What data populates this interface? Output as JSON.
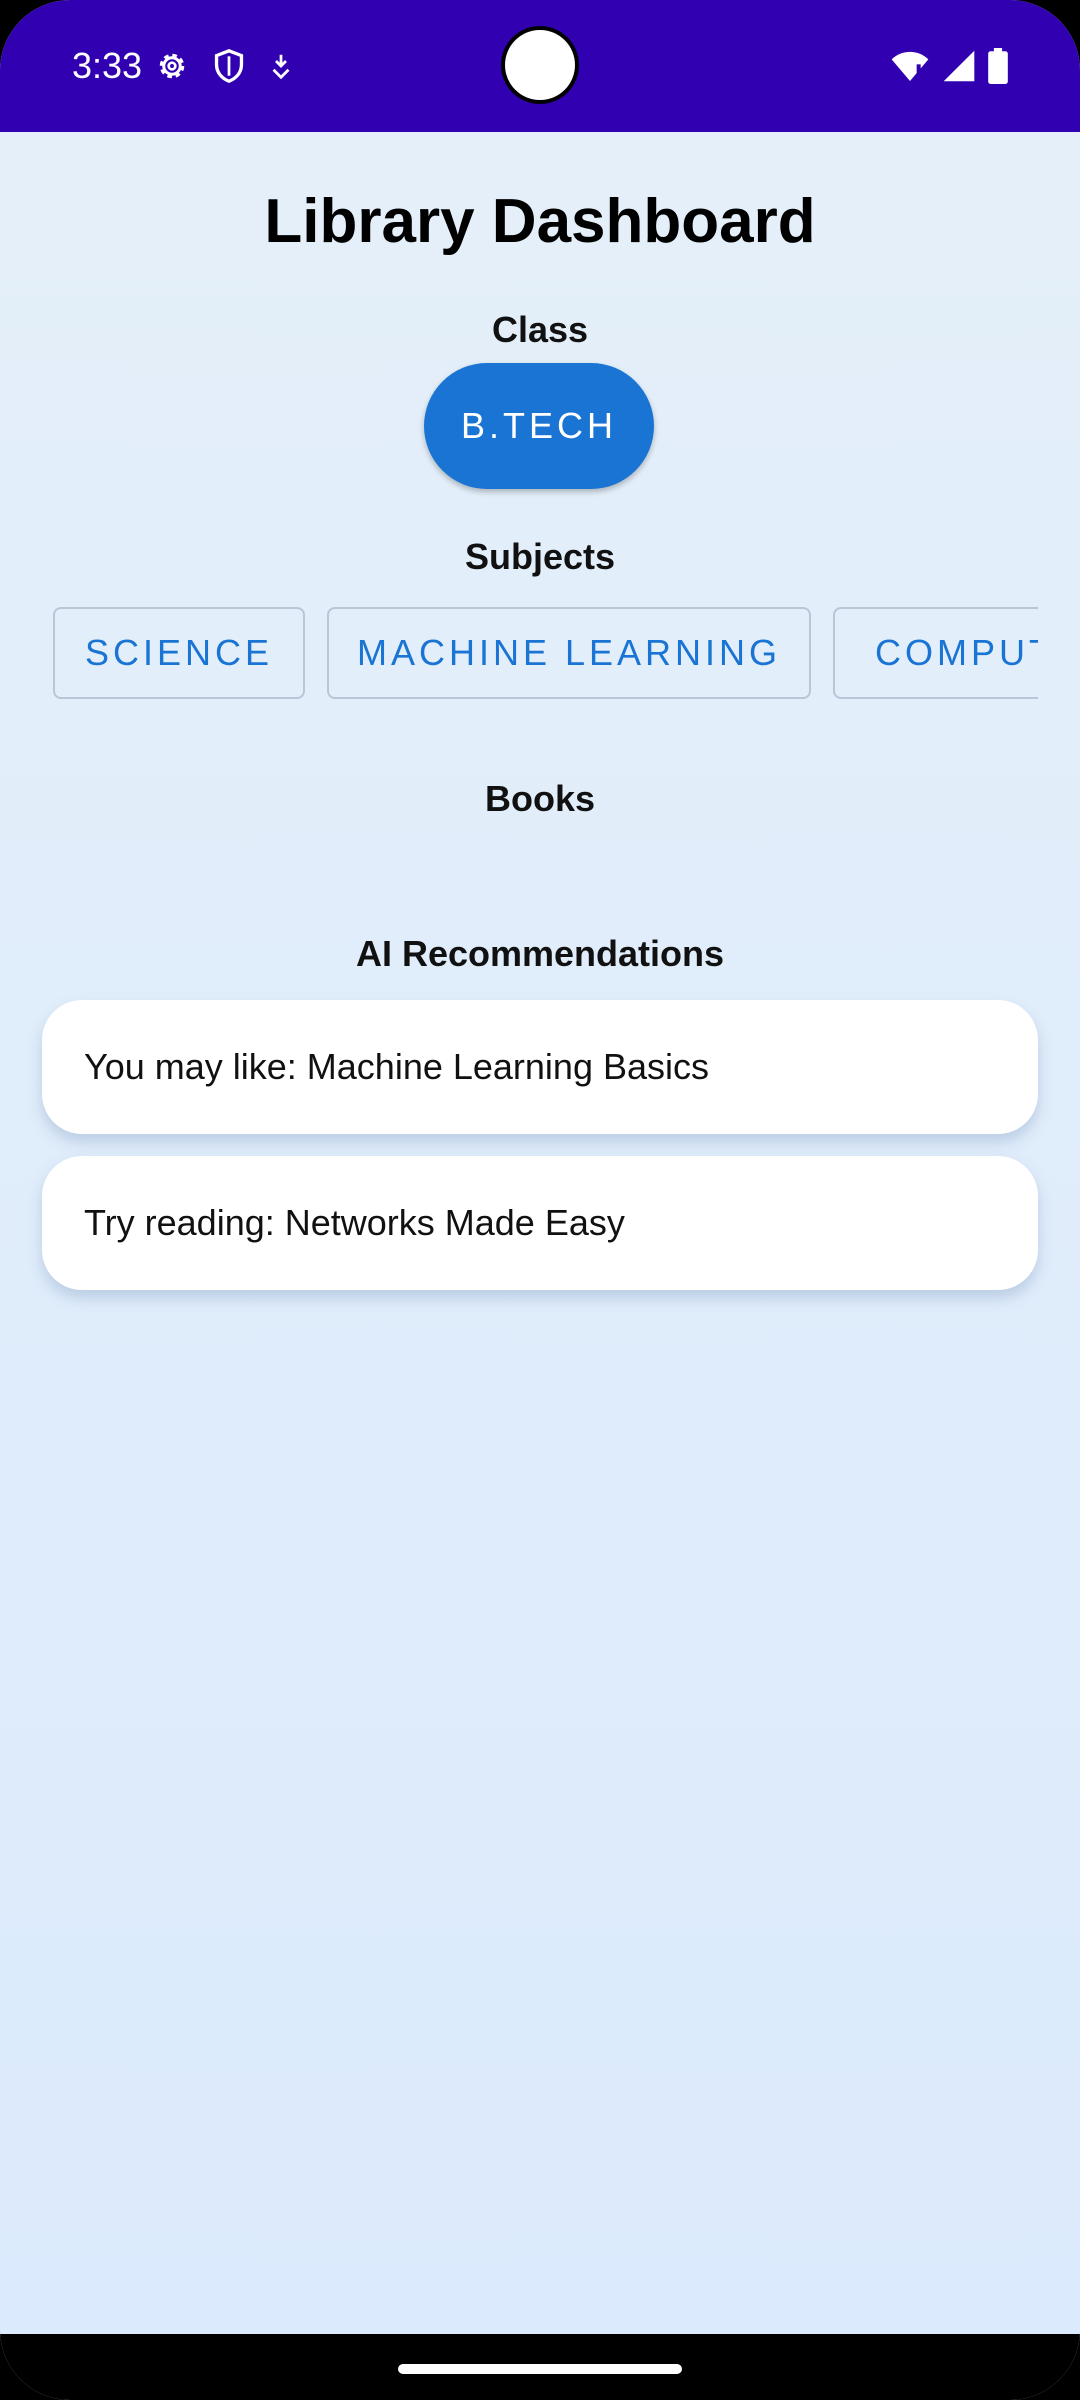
{
  "status_bar": {
    "time": "3:33",
    "icons_left": [
      "settings-icon",
      "shield-icon",
      "download-icon"
    ],
    "icons_right": [
      "wifi-icon",
      "signal-icon",
      "battery-icon"
    ],
    "background": "#3100b1"
  },
  "page": {
    "title": "Library Dashboard",
    "background": "#e4eff9"
  },
  "class_section": {
    "label": "Class",
    "selected": "B.TECH",
    "chip_color": "#1a74d4"
  },
  "subjects_section": {
    "label": "Subjects",
    "items": [
      {
        "label": "SCIENCE"
      },
      {
        "label": "MACHINE LEARNING"
      },
      {
        "label": "COMPUT"
      }
    ],
    "accent": "#1a74d4"
  },
  "books_section": {
    "label": "Books"
  },
  "recommendations": {
    "label": "AI Recommendations",
    "items": [
      {
        "text": "You may like: Machine Learning Basics"
      },
      {
        "text": "Try reading: Networks Made Easy"
      }
    ]
  }
}
